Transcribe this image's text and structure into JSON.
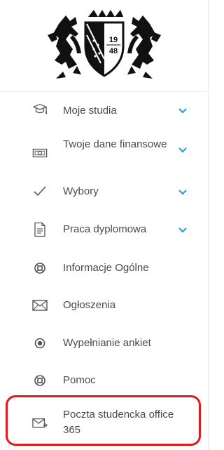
{
  "sidebar": {
    "logo": {
      "name": "university-crest-logo",
      "year_top": "19",
      "year_bottom": "48"
    },
    "items": [
      {
        "label": "Moje studia",
        "icon": "graduation-cap-icon",
        "expandable": true
      },
      {
        "label": "Twoje dane finansowe",
        "icon": "banknote-icon",
        "expandable": true
      },
      {
        "label": "Wybory",
        "icon": "checkmark-icon",
        "expandable": true
      },
      {
        "label": "Praca dyplomowa",
        "icon": "document-icon",
        "expandable": true
      },
      {
        "label": "Informacje Ogólne",
        "icon": "lifebuoy-icon",
        "expandable": false
      },
      {
        "label": "Ogłoszenia",
        "icon": "envelope-icon",
        "expandable": false
      },
      {
        "label": "Wypełnianie ankiet",
        "icon": "radio-target-icon",
        "expandable": false
      },
      {
        "label": "Pomoc",
        "icon": "lifebuoy-icon",
        "expandable": false
      },
      {
        "label": "Poczta studencka office 365",
        "icon": "mail-forward-icon",
        "expandable": false
      }
    ]
  },
  "colors": {
    "chevron": "#2a9fd6",
    "icon": "#555555",
    "highlight": "#e0191c"
  }
}
